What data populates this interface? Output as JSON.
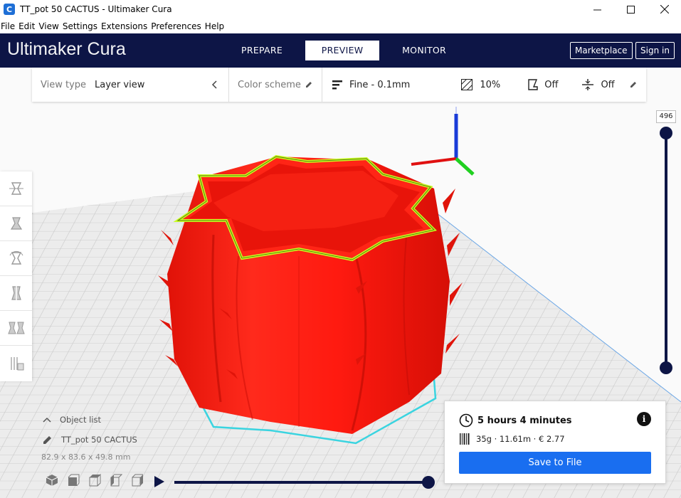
{
  "window": {
    "title": "TT_pot 50 CACTUS - Ultimaker Cura"
  },
  "menu": [
    "File",
    "Edit",
    "View",
    "Settings",
    "Extensions",
    "Preferences",
    "Help"
  ],
  "header": {
    "logo_light": "Ultimaker",
    "logo_bold": "Cura",
    "tabs": [
      "PREPARE",
      "PREVIEW",
      "MONITOR"
    ],
    "active_tab": "PREVIEW",
    "marketplace": "Marketplace",
    "sign_in": "Sign in"
  },
  "view_bar": {
    "view_type_label": "View type",
    "view_type_value": "Layer view",
    "color_scheme_label": "Color scheme",
    "profile": "Fine - 0.1mm",
    "infill": "10%",
    "support": "Off",
    "adhesion": "Off"
  },
  "layer_slider": {
    "value": "496",
    "position": 1.0
  },
  "object": {
    "list_label": "Object list",
    "name": "TT_pot 50 CACTUS",
    "dimensions": "82.9 x 83.6 x 49.8 mm"
  },
  "simulation": {
    "progress": 1.0
  },
  "print_panel": {
    "time": "5 hours 4 minutes",
    "material": "35g · 11.61m · € 2.77",
    "save_button": "Save to File"
  },
  "colors": {
    "header_bg": "#0d1546",
    "model": "#ff1a10",
    "accent": "#196ef0",
    "skirt": "#3ad4e0"
  }
}
